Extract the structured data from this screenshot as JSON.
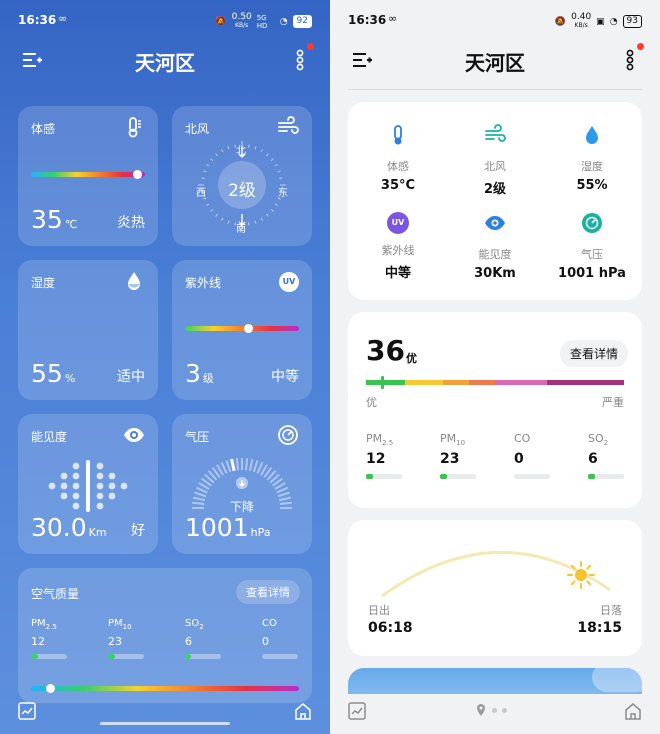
{
  "left": {
    "status": {
      "time": "16:36",
      "net_speed": "0.50",
      "net_unit": "KB/s",
      "signal": "5G HD",
      "battery": "92"
    },
    "title": "天河区",
    "feels": {
      "label": "体感",
      "value": "35",
      "unit": "℃",
      "state": "炎热",
      "level": 0.93
    },
    "wind": {
      "label": "北风",
      "level": "2级",
      "n": "北",
      "s": "南",
      "w": "西",
      "e": "东"
    },
    "humidity": {
      "label": "湿度",
      "value": "55",
      "unit": "%",
      "state": "适中"
    },
    "uv": {
      "label": "紫外线",
      "value": "3",
      "unit": "级",
      "state": "中等",
      "icon": "UV",
      "level": 0.55
    },
    "visibility": {
      "label": "能见度",
      "value": "30.0",
      "unit": "Km",
      "state": "好"
    },
    "pressure": {
      "label": "气压",
      "value": "1001",
      "unit": "hPa",
      "trend": "下降"
    },
    "air": {
      "label": "空气质量",
      "detail": "查看详情",
      "items": [
        {
          "name": "PM",
          "sub": "2.5",
          "value": "12",
          "level": 0.2
        },
        {
          "name": "PM",
          "sub": "10",
          "value": "23",
          "level": 0.2
        },
        {
          "name": "SO",
          "sub": "2",
          "value": "6",
          "level": 0.15
        },
        {
          "name": "CO",
          "sub": "",
          "value": "0",
          "level": 0.0
        }
      ],
      "level": 0.07
    }
  },
  "right": {
    "status": {
      "time": "16:36",
      "net_speed": "0.40",
      "net_unit": "KB/s",
      "battery": "93"
    },
    "title": "天河区",
    "grid": [
      {
        "label": "体感",
        "value": "35°C"
      },
      {
        "label": "北风",
        "value": "2级"
      },
      {
        "label": "湿度",
        "value": "55%"
      },
      {
        "label": "紫外线",
        "value": "中等",
        "icon": "UV"
      },
      {
        "label": "能见度",
        "value": "30Km"
      },
      {
        "label": "气压",
        "value": "1001 hPa"
      }
    ],
    "aqi": {
      "value": "36",
      "level": "优",
      "detail": "查看详情",
      "best": "优",
      "worst": "严重",
      "marker": 0.06,
      "items": [
        {
          "name": "PM",
          "sub": "2.5",
          "value": "12",
          "level": 0.2
        },
        {
          "name": "PM",
          "sub": "10",
          "value": "23",
          "level": 0.2
        },
        {
          "name": "CO",
          "sub": "",
          "value": "0",
          "level": 0.0
        },
        {
          "name": "SO",
          "sub": "2",
          "value": "6",
          "level": 0.2
        }
      ]
    },
    "sun": {
      "rise_label": "日出",
      "rise": "06:18",
      "set_label": "日落",
      "set": "18:15"
    }
  },
  "colors": {
    "accent_green": "#39c44d",
    "badge_red": "#ff3b30",
    "icon_blue": "#2d7fe0",
    "icon_teal": "#17b2a0",
    "icon_purple": "#7a55e0"
  }
}
